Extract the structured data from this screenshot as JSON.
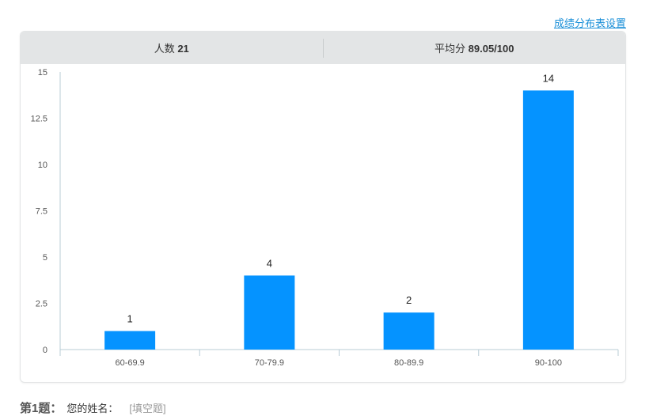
{
  "header": {
    "settings_link": "成绩分布表设置"
  },
  "stats": {
    "count_label": "人数",
    "count_value": "21",
    "avg_label": "平均分",
    "avg_value": "89.05/100"
  },
  "chart_data": {
    "type": "bar",
    "categories": [
      "60-69.9",
      "70-79.9",
      "80-89.9",
      "90-100"
    ],
    "values": [
      1,
      4,
      2,
      14
    ],
    "ylim": [
      0,
      15
    ],
    "yticks": [
      0,
      2.5,
      5,
      7.5,
      10,
      12.5,
      15
    ],
    "ytick_labels": [
      "0",
      "2.5",
      "5",
      "7.5",
      "10",
      "12.5",
      "15"
    ],
    "bar_color": "#0593ff",
    "axis_color": "#b8ccd6",
    "grid": false,
    "title": "",
    "xlabel": "",
    "ylabel": ""
  },
  "question": {
    "number": "第1题：",
    "text": "您的姓名：",
    "type": "[填空题]"
  }
}
